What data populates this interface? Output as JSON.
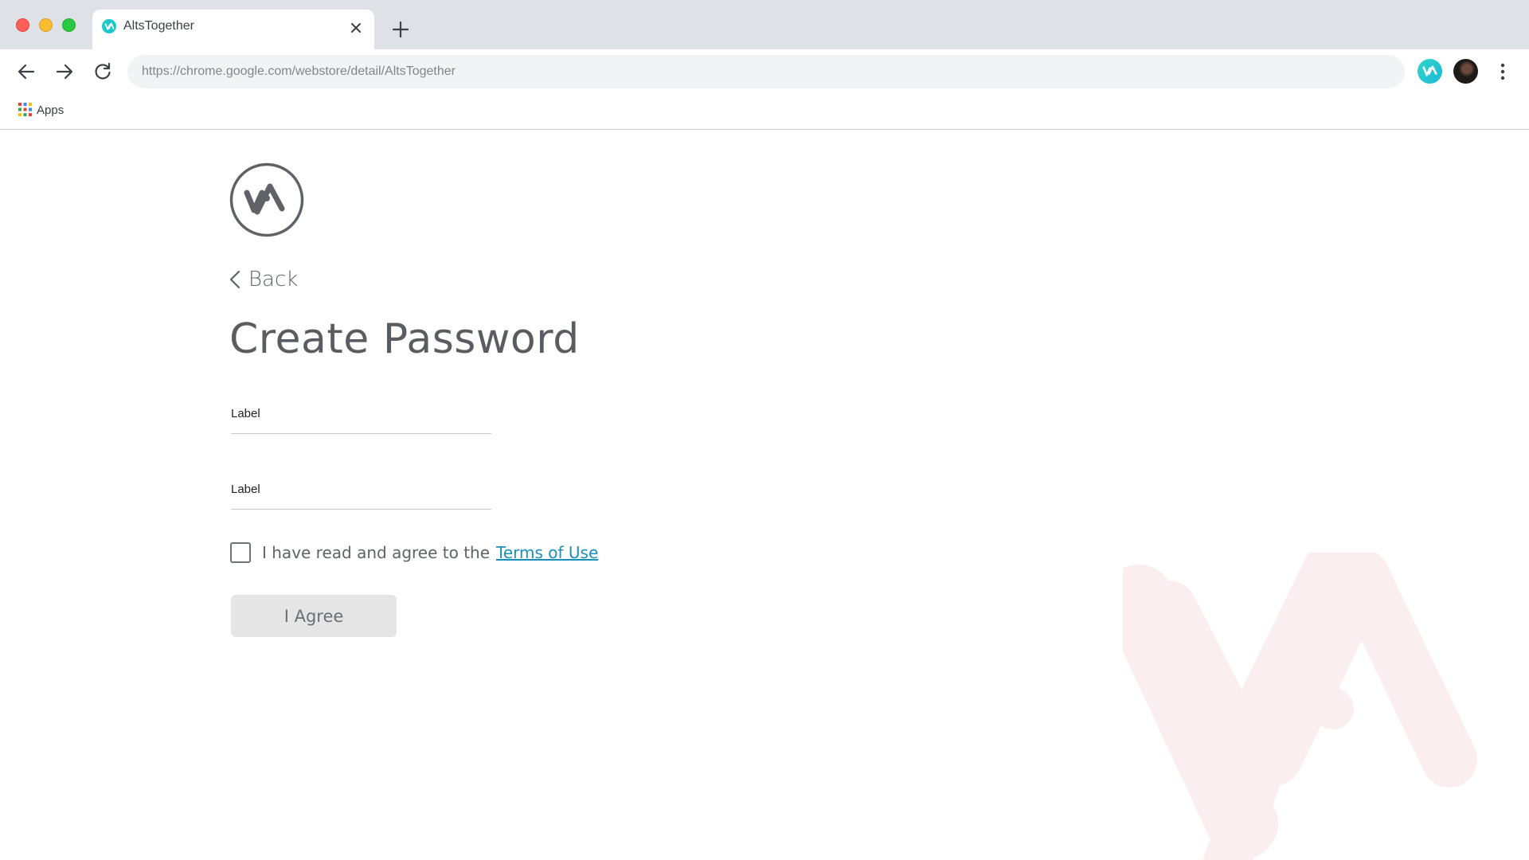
{
  "browser": {
    "tab": {
      "title": "AltsTogether",
      "favicon": "altstogether-logo-icon",
      "close_icon": "close-icon"
    },
    "new_tab_icon": "plus-icon",
    "nav": {
      "back_icon": "arrow-left-icon",
      "forward_icon": "arrow-right-icon",
      "reload_icon": "reload-icon"
    },
    "url": "https://chrome.google.com/webstore/detail/AltsTogether",
    "extension_icon": "altstogether-extension-icon",
    "profile_icon": "profile-avatar",
    "menu_icon": "kebab-menu-icon",
    "bookmarks": {
      "apps_label": "Apps",
      "apps_icon": "apps-grid-icon"
    }
  },
  "page": {
    "logo_icon": "altstogether-logo-icon",
    "back": {
      "label": "Back",
      "icon": "chevron-left-icon"
    },
    "title": "Create Password",
    "fields": [
      {
        "label": "Label",
        "value": ""
      },
      {
        "label": "Label",
        "value": ""
      }
    ],
    "agreement": {
      "text": "I have read and agree to the",
      "link": "Terms of Use",
      "checked": false
    },
    "submit_label": "I Agree"
  },
  "colors": {
    "brand_teal": "#1ec8c8",
    "link": "#1a8fb8",
    "watermark": "#fbeef0",
    "button_disabled_bg": "#e5e5e5"
  }
}
